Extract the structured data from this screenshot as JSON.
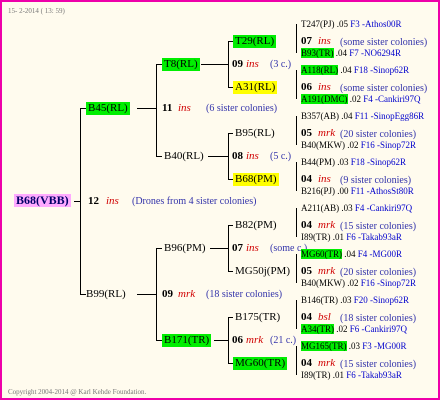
{
  "header": "15- 2-2014 ( 13: 59)",
  "footer": "Copyright 2004-2014 @ Karl Kehde Foundation.",
  "root": {
    "label": "B68(VBB)",
    "num": "12",
    "ins": "ins",
    "note": "(Drones from 4 sister colonies)"
  },
  "upper": {
    "label": "B45(RL)",
    "num": "11",
    "ins": "ins",
    "note": "(6 sister colonies)"
  },
  "lower": {
    "label": "B99(RL)",
    "num": "09",
    "ins": "mrk",
    "note": "(18 sister colonies)"
  },
  "g2": [
    {
      "label": "T8(RL)",
      "num": "09",
      "ins": "ins",
      "note": "(3 c.)"
    },
    {
      "label": "B40(RL)",
      "num": "08",
      "ins": "ins",
      "note": "(5 c.)"
    },
    {
      "label": "B96(PM)",
      "num": "07",
      "ins": "ins",
      "note": "(some c.)"
    },
    {
      "label": "B171(TR)",
      "num": "06",
      "ins": "mrk",
      "note": "(21 c.)"
    }
  ],
  "g3": [
    {
      "label": "T29(RL)",
      "num": "07",
      "ins": "ins",
      "note": "(some sister colonies)"
    },
    {
      "label": "A31(RL)",
      "num": "06",
      "ins": "ins",
      "note": "(some sister colonies)"
    },
    {
      "label": "B95(RL)",
      "num": "05",
      "ins": "mrk",
      "note": "(20 sister colonies)"
    },
    {
      "label": "B68(PM)",
      "num": "04",
      "ins": "ins",
      "note": "(9 sister colonies)"
    },
    {
      "label": "B82(PM)",
      "num": "04",
      "ins": "mrk",
      "note": "(15 sister colonies)"
    },
    {
      "label": "MG50j(PM)",
      "num": "05",
      "ins": "mrk",
      "note": "(20 sister colonies)"
    },
    {
      "label": "B175(TR)",
      "num": "04",
      "ins": "bsl",
      "note": "(18 sister colonies)"
    },
    {
      "label": "MG60(TR)",
      "num": "04",
      "ins": "mrk",
      "note": "(15 sister colonies)"
    }
  ],
  "g4": [
    {
      "label": "T247(PJ)",
      "year": ".05",
      "tail": "F3 -Athos00R"
    },
    {
      "label": "B93(TR)",
      "year": ".04",
      "tail": "F7 -NO6294R"
    },
    {
      "label": "A118(RL)",
      "year": ".04",
      "tail": "F18 -Sinop62R"
    },
    {
      "label": "A191(DMC)",
      "year": ".02",
      "tail": "F4 -Cankiri97Q"
    },
    {
      "label": "B357(AB)",
      "year": ".04",
      "tail": "F11 -SinopEgg86R"
    },
    {
      "label": "B40(MKW)",
      "year": ".02",
      "tail": "F16 -Sinop72R"
    },
    {
      "label": "B44(PM)",
      "year": ".03",
      "tail": "F18 -Sinop62R"
    },
    {
      "label": "B216(PJ)",
      "year": ".00",
      "tail": "F11 -AthosSt80R"
    },
    {
      "label": "A211(AB)",
      "year": ".03",
      "tail": "F4 -Cankiri97Q"
    },
    {
      "label": "I89(TR)",
      "year": ".01",
      "tail": "F6 -Takab93aR"
    },
    {
      "label": "MG60(TR)",
      "year": ".04",
      "tail": "F4 -MG00R"
    },
    {
      "label": "B40(MKW)",
      "year": ".02",
      "tail": "F16 -Sinop72R"
    },
    {
      "label": "B146(TR)",
      "year": ".03",
      "tail": "F20 -Sinop62R"
    },
    {
      "label": "A34(TR)",
      "year": ".02",
      "tail": "F6 -Cankiri97Q"
    },
    {
      "label": "MG165(TR)",
      "year": ".03",
      "tail": "F3 -MG00R"
    },
    {
      "label": "I89(TR)",
      "year": ".01",
      "tail": "F6 -Takab93aR"
    }
  ]
}
